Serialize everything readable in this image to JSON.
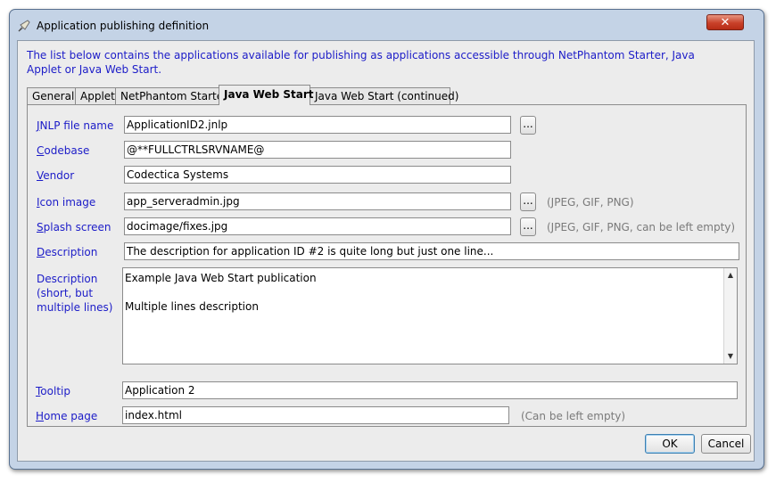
{
  "window": {
    "title": "Application publishing definition",
    "close_glyph": "✕"
  },
  "intro_text": "The list below contains the applications available for publishing as applications accessible through NetPhantom Starter, Java Applet or Java Web Start.",
  "tabs": [
    {
      "label": "General",
      "active": false
    },
    {
      "label": "Applet",
      "active": false
    },
    {
      "label": "NetPhantom Starter",
      "active": false
    },
    {
      "label": "Java Web Start",
      "active": true
    },
    {
      "label": "Java Web Start (continued)",
      "active": false
    }
  ],
  "form": {
    "jnlp": {
      "mnemonic": "J",
      "rest": "NLP file name",
      "value": "ApplicationID2.jnlp",
      "browse": "..."
    },
    "codebase": {
      "mnemonic": "C",
      "rest": "odebase",
      "value": "@**FULLCTRLSRVNAME@"
    },
    "vendor": {
      "mnemonic": "V",
      "rest": "endor",
      "value": "Codectica Systems"
    },
    "icon": {
      "mnemonic": "I",
      "rest": "con image",
      "value": "app_serveradmin.jpg",
      "browse": "...",
      "hint": "(JPEG, GIF, PNG)"
    },
    "splash": {
      "mnemonic": "S",
      "rest": "plash screen",
      "value": "docimage/fixes.jpg",
      "browse": "...",
      "hint": "(JPEG, GIF, PNG, can be left empty)"
    },
    "description": {
      "mnemonic": "D",
      "rest": "escription",
      "value": "The description for application ID #2 is quite long but just one line..."
    },
    "description_multi": {
      "label_line1": "Description",
      "label_line2": "(short, but",
      "label_line3": "multiple lines)",
      "value": "Example Java Web Start publication\n\nMultiple lines description"
    },
    "tooltip": {
      "mnemonic": "T",
      "rest": "ooltip",
      "value": "Application 2"
    },
    "homepage": {
      "mnemonic": "H",
      "rest": "ome page",
      "value": "index.html",
      "hint": "(Can be left empty)"
    }
  },
  "buttons": {
    "ok": "OK",
    "cancel": "Cancel"
  },
  "colors": {
    "label_blue": "#1c1cc8",
    "hint_gray": "#7a7a7a",
    "close_red": "#c9412a"
  }
}
